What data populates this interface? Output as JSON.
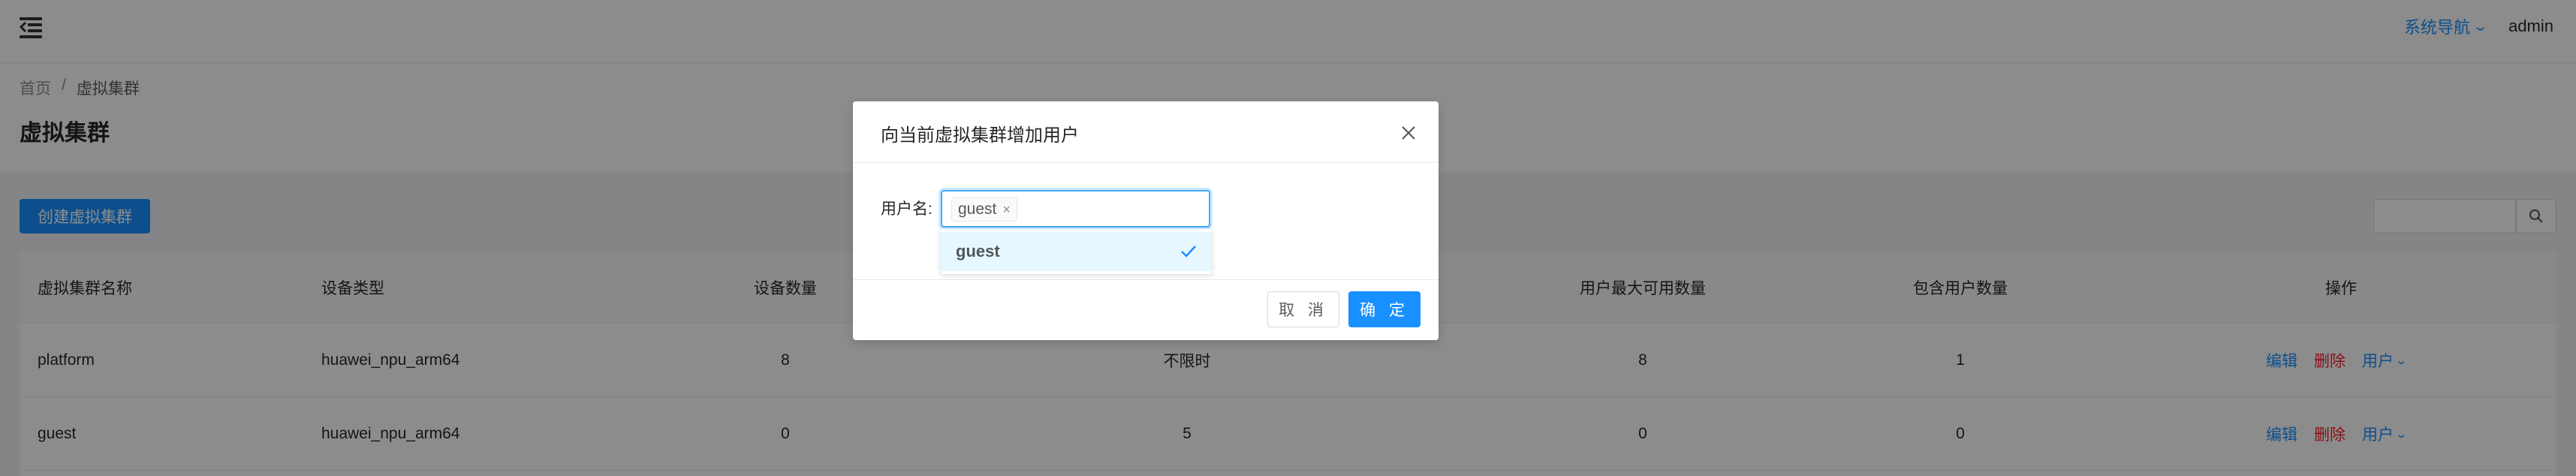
{
  "header": {
    "system_nav": "系统导航",
    "user": "admin"
  },
  "breadcrumb": {
    "home": "首页",
    "separator": "/",
    "current": "虚拟集群"
  },
  "page_title": "虚拟集群",
  "toolbar": {
    "create_label": "创建虚拟集群",
    "search_placeholder": ""
  },
  "table": {
    "columns": [
      "虚拟集群名称",
      "设备类型",
      "设备数量",
      "",
      "用户最大可用数量",
      "包含用户数量",
      "操作"
    ],
    "rows": [
      {
        "name": "platform",
        "device_type": "huawei_npu_arm64",
        "device_count": "8",
        "time_limit": "不限时",
        "max_users": "8",
        "user_count": "1"
      },
      {
        "name": "guest",
        "device_type": "huawei_npu_arm64",
        "device_count": "0",
        "time_limit": "5",
        "max_users": "0",
        "user_count": "0"
      }
    ],
    "actions": {
      "edit": "编辑",
      "delete": "删除",
      "user": "用户"
    }
  },
  "modal": {
    "title": "向当前虚拟集群增加用户",
    "field_label": "用户名:",
    "selected_tag": "guest",
    "cancel_label": "取 消",
    "ok_label": "确 定"
  },
  "dropdown": {
    "options": [
      {
        "label": "guest",
        "selected": true
      }
    ]
  },
  "colors": {
    "primary": "#1890ff",
    "danger": "#f5222d",
    "mask": "rgba(0,0,0,0.45)"
  },
  "icons": [
    "menu-fold-icon",
    "chevron-down-icon",
    "search-icon",
    "close-icon",
    "check-icon"
  ]
}
